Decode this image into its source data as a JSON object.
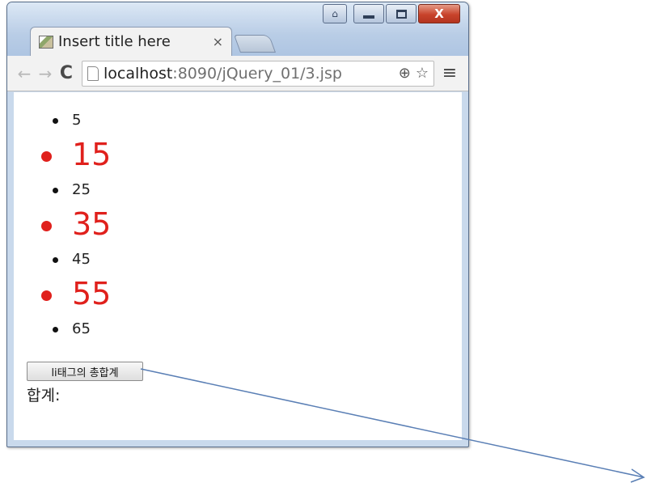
{
  "window": {
    "caption_buttons": {
      "user_icon": "user-icon",
      "minimize_icon": "minimize-icon",
      "maximize_icon": "maximize-icon",
      "close_glyph": "X"
    }
  },
  "tab": {
    "title": "Insert title here",
    "close_glyph": "×"
  },
  "toolbar": {
    "back_glyph": "←",
    "forward_glyph": "→",
    "reload_glyph": "C",
    "url_host": "localhost",
    "url_path": ":8090/jQuery_01/3.jsp",
    "zoom_glyph": "⊕",
    "star_glyph": "☆",
    "menu_glyph": "≡"
  },
  "page": {
    "list_items": [
      {
        "text": "5",
        "highlighted": false
      },
      {
        "text": "15",
        "highlighted": true
      },
      {
        "text": "25",
        "highlighted": false
      },
      {
        "text": "35",
        "highlighted": true
      },
      {
        "text": "45",
        "highlighted": false
      },
      {
        "text": "55",
        "highlighted": true
      },
      {
        "text": "65",
        "highlighted": false
      }
    ],
    "button_label": "li태그의 총합계",
    "sum_label": "합계:"
  },
  "colors": {
    "highlight": "#e0201c",
    "arrow": "#5a7fb5"
  }
}
